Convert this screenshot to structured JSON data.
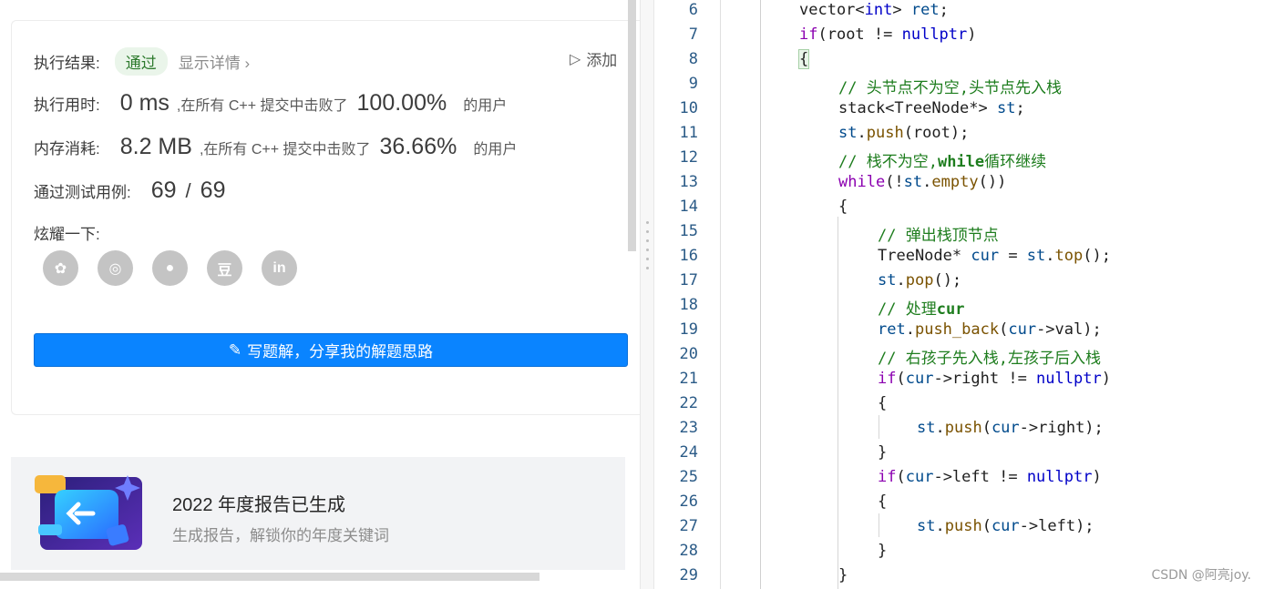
{
  "result": {
    "label_result": "执行结果:",
    "status": "通过",
    "details_link": "显示详情 ›",
    "add_note": "添加",
    "label_runtime": "执行用时:",
    "runtime_value": "0 ms",
    "runtime_mid": ",在所有 C++ 提交中击败了",
    "runtime_percent": "100.00%",
    "runtime_tail": "的用户",
    "label_memory": "内存消耗:",
    "memory_value": "8.2 MB",
    "memory_mid": ",在所有 C++ 提交中击败了",
    "memory_percent": "36.66%",
    "memory_tail": "的用户",
    "label_tests": "通过测试用例:",
    "tests_passed": "69",
    "tests_sep": "/",
    "tests_total": "69",
    "label_share": "炫耀一下:"
  },
  "share_icons": [
    {
      "name": "wechat-icon",
      "glyph": "✿"
    },
    {
      "name": "weibo-icon",
      "glyph": "◎"
    },
    {
      "name": "qq-icon",
      "glyph": "●"
    },
    {
      "name": "douban-icon",
      "glyph": "豆"
    },
    {
      "name": "linkedin-icon",
      "glyph": "in"
    }
  ],
  "write_button": "写题解，分享我的解题思路",
  "report": {
    "title": "2022 年度报告已生成",
    "subtitle": "生成报告，解锁你的年度关键词"
  },
  "code": {
    "line_numbers": [
      "6",
      "7",
      "8",
      "9",
      "10",
      "11",
      "12",
      "13",
      "14",
      "15",
      "16",
      "17",
      "18",
      "19",
      "20",
      "21",
      "22",
      "23",
      "24",
      "25",
      "26",
      "27",
      "28",
      "29"
    ],
    "lines": [
      "vector<int> ret;",
      "if(root != nullptr)",
      "{",
      "// 头节点不为空,头节点先入栈",
      "stack<TreeNode*> st;",
      "st.push(root);",
      "// 栈不为空,while循环继续",
      "while(!st.empty())",
      "{",
      "// 弹出栈顶节点",
      "TreeNode* cur = st.top();",
      "st.pop();",
      "// 处理cur",
      "ret.push_back(cur->val);",
      "// 右孩子先入栈,左孩子后入栈",
      "if(cur->right != nullptr)",
      "{",
      "st.push(cur->right);",
      "}",
      "if(cur->left != nullptr)",
      "{",
      "st.push(cur->left);",
      "}",
      "}"
    ]
  },
  "watermark": "CSDN @阿亮joy.",
  "colors": {
    "accent": "#0a84ff",
    "pass": "#2d7a2d",
    "keyword": "#8b00b0",
    "type": "#0000c8",
    "comment": "#1e7d1e"
  }
}
